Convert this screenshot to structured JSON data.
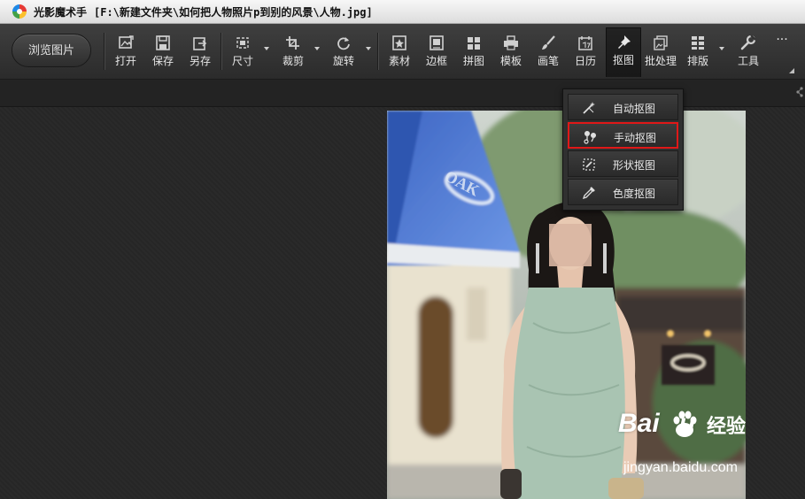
{
  "window": {
    "app_name": "光影魔术手",
    "file_path": "[F:\\新建文件夹\\如何把人物照片p到别的风景\\人物.jpg]"
  },
  "toolbar": {
    "browse_label": "浏览图片",
    "tools": {
      "open": "打开",
      "save": "保存",
      "save_as": "另存",
      "size": "尺寸",
      "crop": "裁剪",
      "rotate": "旋转",
      "material": "素材",
      "border": "边框",
      "collage": "拼图",
      "template": "模板",
      "brush": "画笔",
      "calendar": "日历",
      "cutout": "抠图",
      "batch": "批处理",
      "layout": "排版",
      "tools": "工具",
      "more": "···"
    },
    "active_tool": "抠图"
  },
  "cutout_menu": {
    "items": [
      {
        "label": "自动抠图",
        "icon": "magic-wand-icon",
        "highlighted": false
      },
      {
        "label": "手动抠图",
        "icon": "manual-select-icon",
        "highlighted": true
      },
      {
        "label": "形状抠图",
        "icon": "shape-select-icon",
        "highlighted": false
      },
      {
        "label": "色度抠图",
        "icon": "color-picker-icon",
        "highlighted": false
      }
    ],
    "highlight_color": "#e01818"
  },
  "photo_sign": {
    "text": "OAK"
  },
  "watermark": {
    "brand_left": "Bai",
    "brand_right": "u",
    "sub": "经验",
    "url": "jingyan.baidu.com"
  },
  "colors": {
    "toolbar_bg": "#333333",
    "canvas_bg": "#262626",
    "awning_blue": "#4d79d6",
    "dress_green": "#a9c4b2"
  }
}
